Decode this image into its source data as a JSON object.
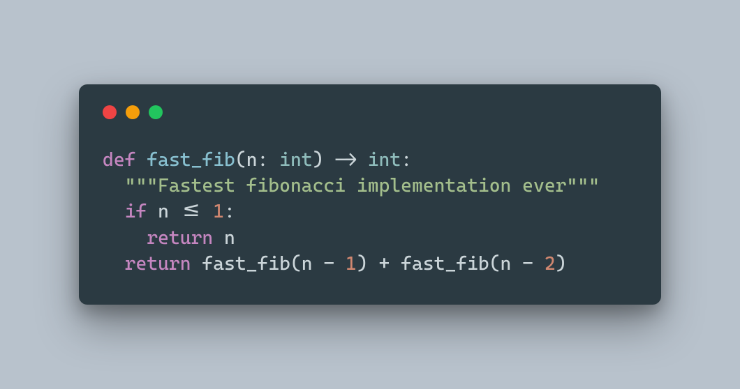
{
  "window": {
    "controls": [
      "close",
      "minimize",
      "zoom"
    ]
  },
  "code": {
    "lang": "python",
    "tokens": [
      [
        {
          "t": "def",
          "c": "kw"
        },
        {
          "t": " ",
          "c": "sp"
        },
        {
          "t": "fast_fib",
          "c": "funcname"
        },
        {
          "t": "(",
          "c": "punc"
        },
        {
          "t": "n",
          "c": "id"
        },
        {
          "t": ": ",
          "c": "punc"
        },
        {
          "t": "int",
          "c": "type"
        },
        {
          "t": ")",
          "c": "punc"
        },
        {
          "t": " -> ",
          "c": "op"
        },
        {
          "t": "int",
          "c": "type"
        },
        {
          "t": ":",
          "c": "punc"
        }
      ],
      [
        {
          "t": "  ",
          "c": "sp"
        },
        {
          "t": "\"\"\"Fastest fibonacci implementation ever\"\"\"",
          "c": "str"
        }
      ],
      [
        {
          "t": "  ",
          "c": "sp"
        },
        {
          "t": "if",
          "c": "kw"
        },
        {
          "t": " n <= ",
          "c": "op"
        },
        {
          "t": "1",
          "c": "num"
        },
        {
          "t": ":",
          "c": "punc"
        }
      ],
      [
        {
          "t": "    ",
          "c": "sp"
        },
        {
          "t": "return",
          "c": "kw"
        },
        {
          "t": " n",
          "c": "id"
        }
      ],
      [
        {
          "t": "  ",
          "c": "sp"
        },
        {
          "t": "return",
          "c": "kw"
        },
        {
          "t": " fast_fib(n - ",
          "c": "id"
        },
        {
          "t": "1",
          "c": "num"
        },
        {
          "t": ") + fast_fib(n - ",
          "c": "id"
        },
        {
          "t": "2",
          "c": "num"
        },
        {
          "t": ")",
          "c": "punc"
        }
      ]
    ]
  }
}
